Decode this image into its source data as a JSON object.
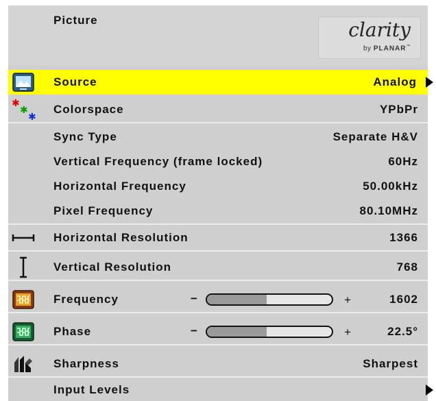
{
  "menu": {
    "title": "Picture",
    "logo": {
      "main": "clarity",
      "sub_prefix": "by ",
      "sub_brand": "PLANAR",
      "tm": "™"
    },
    "rows": [
      {
        "label": "Source",
        "value": "Analog",
        "icon": "monitor-icon",
        "selected": true,
        "has_arrow": true
      },
      {
        "label": "Colorspace",
        "value": "YPbPr",
        "icon": "color-dots-icon"
      },
      {
        "label": "Sync Type",
        "value": "Separate H&V"
      },
      {
        "label": "Vertical Frequency (frame locked)",
        "value": "60Hz"
      },
      {
        "label": "Horizontal Frequency",
        "value": "50.00kHz"
      },
      {
        "label": "Pixel Frequency",
        "value": "80.10MHz"
      },
      {
        "label": "Horizontal Resolution",
        "value": "1366",
        "icon": "horizontal-resolution-icon"
      },
      {
        "label": "Vertical Resolution",
        "value": "768",
        "icon": "vertical-resolution-icon"
      },
      {
        "label": "Frequency",
        "value": "1602",
        "icon": "frequency-icon",
        "slider": {
          "minus": "−",
          "plus": "+",
          "level": 0.48
        }
      },
      {
        "label": "Phase",
        "value": "22.5°",
        "icon": "phase-icon",
        "slider": {
          "minus": "−",
          "plus": "+",
          "level": 0.48
        }
      },
      {
        "label": "Sharpness",
        "value": "Sharpest",
        "icon": "sharpness-icon"
      },
      {
        "label": "Input Levels",
        "value": "",
        "has_arrow": true
      }
    ]
  },
  "colors": {
    "selected_row": "#ffff00",
    "row_bg": "#cfcfcf",
    "text": "#111111"
  }
}
